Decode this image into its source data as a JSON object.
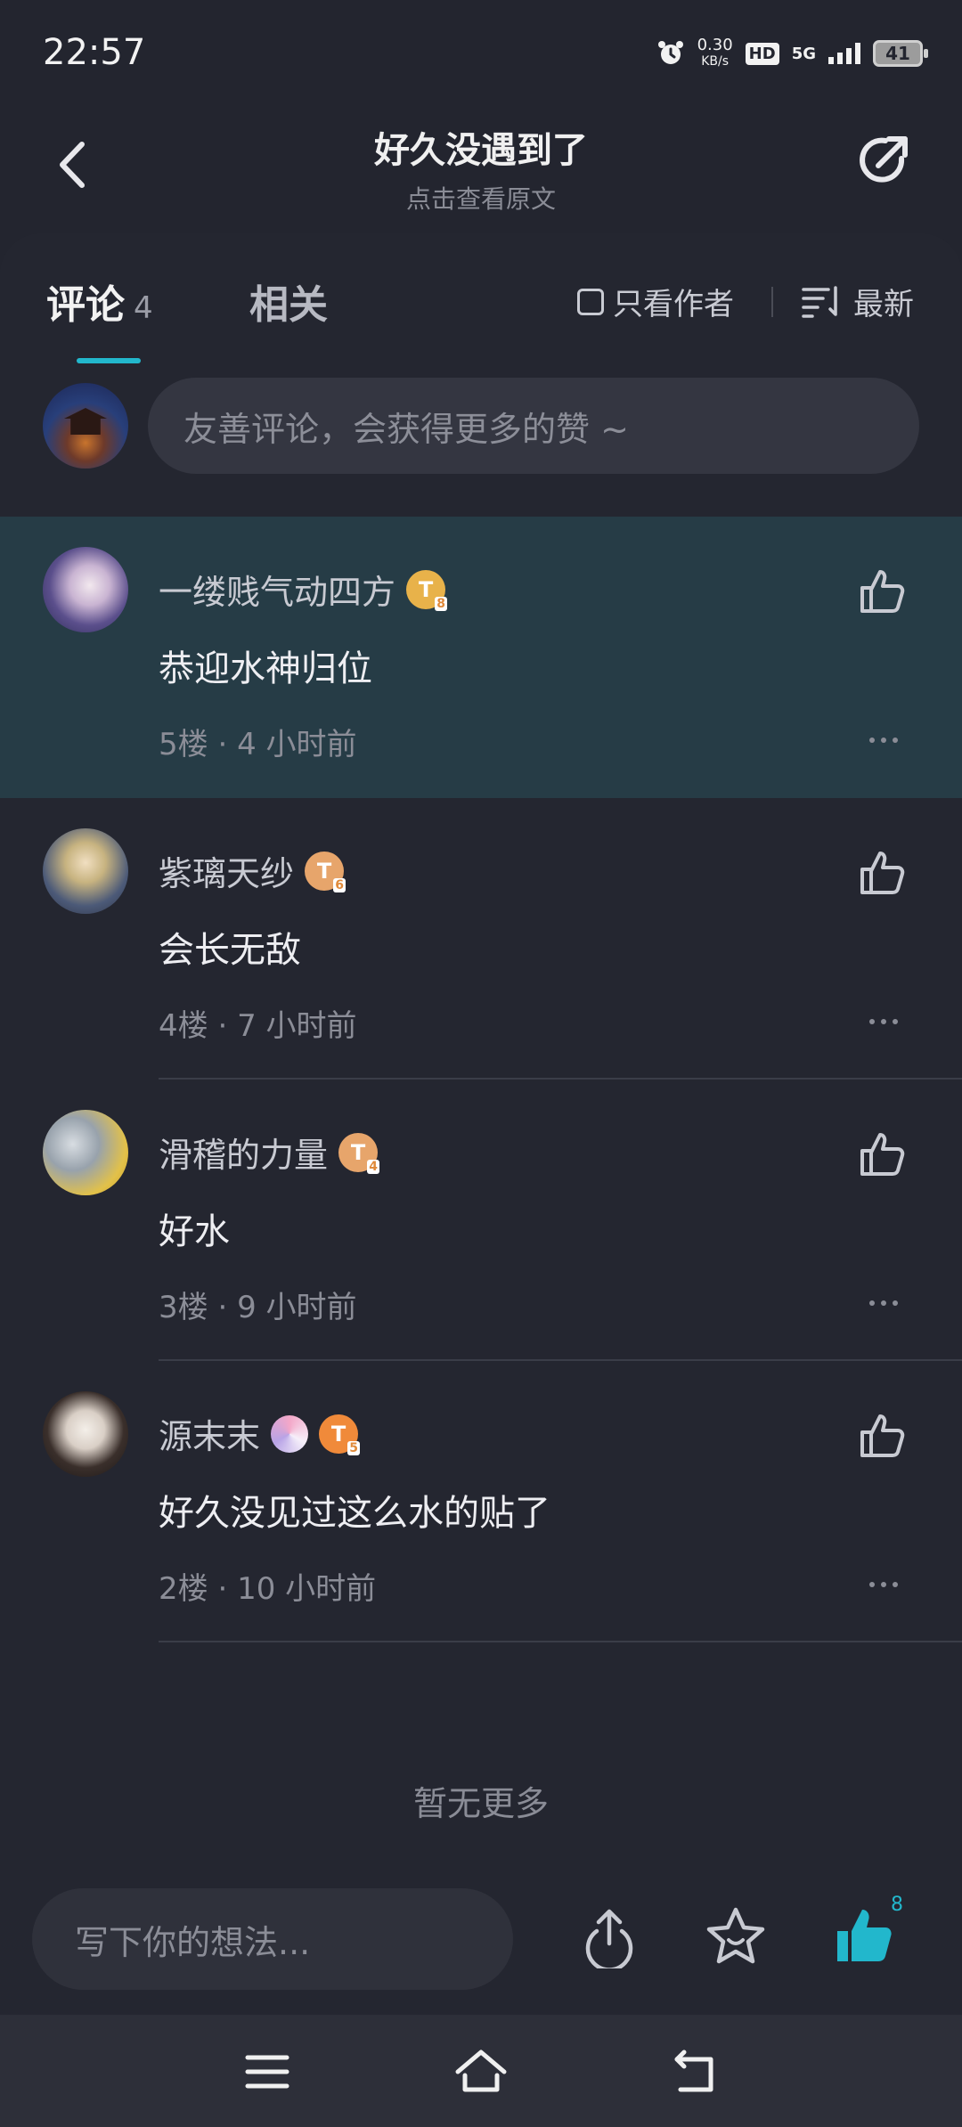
{
  "status_bar": {
    "time": "22:57",
    "speed_value": "0.30",
    "speed_unit": "KB/s",
    "hd": "HD",
    "network": "5G",
    "battery": "41"
  },
  "header": {
    "title": "好久没遇到了",
    "subtitle": "点击查看原文",
    "back_icon": "back-arrow-icon",
    "share_icon": "share-arrow-icon"
  },
  "tabs": {
    "comments_label": "评论",
    "comments_count": "4",
    "related_label": "相关",
    "only_author": "只看作者",
    "sort": "最新",
    "accent_color": "#22b7cc"
  },
  "comment_input": {
    "placeholder": "友善评论，会获得更多的赞 ~"
  },
  "comments": [
    {
      "name": "一缕贱气动四方",
      "level": "T",
      "level_num": "8",
      "text": "恭迎水神归位",
      "floor": "5楼",
      "time": "4 小时前",
      "highlighted": true
    },
    {
      "name": "紫璃天纱",
      "level": "T",
      "level_num": "6",
      "text": "会长无敌",
      "floor": "4楼",
      "time": "7 小时前"
    },
    {
      "name": "滑稽的力量",
      "level": "T",
      "level_num": "4",
      "text": "好水",
      "floor": "3楼",
      "time": "9 小时前"
    },
    {
      "name": "源末末",
      "level": "T",
      "level_num": "5",
      "text": "好久没见过这么水的贴了",
      "floor": "2楼",
      "time": "10 小时前"
    }
  ],
  "footer": {
    "no_more": "暂无更多"
  },
  "bottom_bar": {
    "write_placeholder": "写下你的想法...",
    "like_count": "8"
  }
}
